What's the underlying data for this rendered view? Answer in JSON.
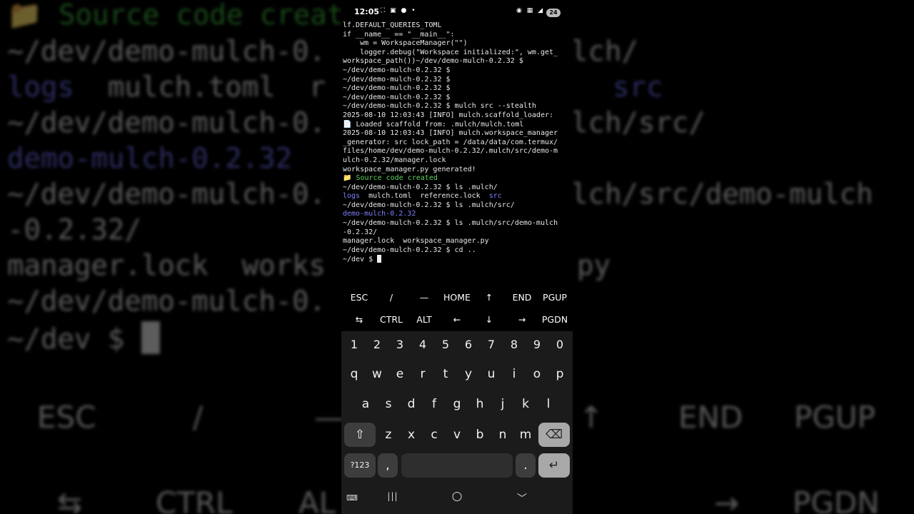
{
  "status_bar": {
    "time": "12:05",
    "left_icons": "⛶ ▣ ● •",
    "right_icons": "◉ ▦ ◢",
    "battery": "24"
  },
  "terminal": {
    "line_01": "lf.DEFAULT_QUERIES_TOML",
    "line_02": "",
    "line_03": "",
    "line_04": "if __name__ == \"__main__\":",
    "line_05": "    wm = WorkspaceManager(\"\")",
    "line_06": "    logger.debug(\"Workspace initialized:\", wm.get_",
    "line_07": "workspace_path())~/dev/demo-mulch-0.2.32 $",
    "line_08": "~/dev/demo-mulch-0.2.32 $",
    "line_09": "~/dev/demo-mulch-0.2.32 $",
    "line_10": "~/dev/demo-mulch-0.2.32 $",
    "line_11": "~/dev/demo-mulch-0.2.32 $",
    "line_12": "~/dev/demo-mulch-0.2.32 $ mulch src --stealth",
    "line_13": "2025-08-10 12:03:43 [INFO] mulch.scaffold_loader:",
    "line_14": "📄 Loaded scaffold from: .mulch/mulch.toml",
    "line_15": "2025-08-10 12:03:43 [INFO] mulch.workspace_manager",
    "line_16": "_generator: src lock_path = /data/data/com.termux/",
    "line_17": "files/home/dev/demo-mulch-0.2.32/.mulch/src/demo-m",
    "line_18": "ulch-0.2.32/manager.lock",
    "line_19": "workspace_manager.py generated!",
    "line_20": "📁 Source code created",
    "line_21": "~/dev/demo-mulch-0.2.32 $ ls .mulch/",
    "line_22a": "logs",
    "line_22b": "mulch.toml  reference.lock",
    "line_22c": "src",
    "line_23": "~/dev/demo-mulch-0.2.32 $ ls .mulch/src/",
    "line_24": "demo-mulch-0.2.32",
    "line_25": "~/dev/demo-mulch-0.2.32 $ ls .mulch/src/demo-mulch",
    "line_26": "-0.2.32/",
    "line_27": "manager.lock  workspace_manager.py",
    "line_28": "~/dev/demo-mulch-0.2.32 $ cd ..",
    "line_29": "~/dev $"
  },
  "extra_keys": {
    "row1": [
      "ESC",
      "/",
      "—",
      "HOME",
      "↑",
      "END",
      "PGUP"
    ],
    "row2": [
      "⇆",
      "CTRL",
      "ALT",
      "←",
      "↓",
      "→",
      "PGDN"
    ]
  },
  "keyboard": {
    "numbers": [
      "1",
      "2",
      "3",
      "4",
      "5",
      "6",
      "7",
      "8",
      "9",
      "0"
    ],
    "row_q": [
      "q",
      "w",
      "e",
      "r",
      "t",
      "y",
      "u",
      "i",
      "o",
      "p"
    ],
    "row_a": [
      "a",
      "s",
      "d",
      "f",
      "g",
      "h",
      "j",
      "k",
      "l"
    ],
    "row_z": [
      "z",
      "x",
      "c",
      "v",
      "b",
      "n",
      "m"
    ],
    "shift": "⇧",
    "backspace": "⌫",
    "symbols": "?123",
    "comma": ",",
    "period": ".",
    "enter": "↵"
  },
  "nav_bar": {
    "keyboard_toggle": "⌨",
    "recents": "|||",
    "home": "○",
    "back": "﹀"
  },
  "background": {
    "line_1": "Source code creat",
    "line_2": "~/dev/demo-mulch-0.",
    "line_2b": "lch/",
    "line_3a": "logs",
    "line_3b": "  mulch.toml  r",
    "line_3c": "src",
    "line_4": "~/dev/demo-mulch-0.",
    "line_4b": "lch/src/",
    "line_5": "demo-mulch-0.2.32",
    "line_6": "~/dev/demo-mulch-0.",
    "line_6b": "lch/src/demo-mulch",
    "line_7": "-0.2.32/",
    "line_8": "manager.lock  works",
    "line_8b": "py",
    "line_9": "~/dev/demo-mulch-0.",
    "line_10": "~/dev $ ",
    "keys_row1": [
      "ESC",
      "/",
      "—",
      "↑",
      "END",
      "PGUP"
    ],
    "keys_row2": [
      "⇆",
      "CTRL",
      "AL",
      "→",
      "PGDN"
    ]
  }
}
